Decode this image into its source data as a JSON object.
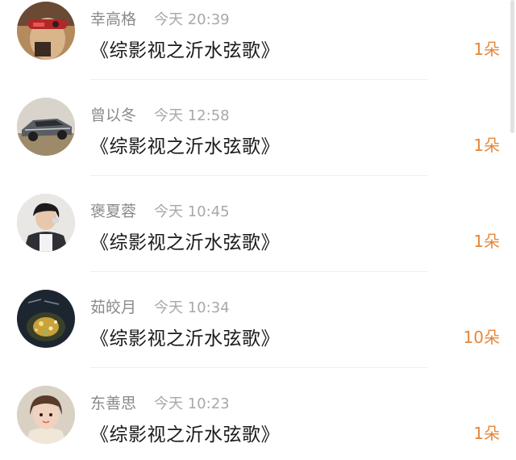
{
  "items": [
    {
      "name": "幸高格",
      "time": "今天 20:39",
      "message": "《综影视之沂水弦歌》",
      "count": "1朵",
      "avatar": "avatar-red-mask"
    },
    {
      "name": "曾以冬",
      "time": "今天 12:58",
      "message": "《综影视之沂水弦歌》",
      "count": "1朵",
      "avatar": "avatar-car"
    },
    {
      "name": "褒夏蓉",
      "time": "今天 10:45",
      "message": "《综影视之沂水弦歌》",
      "count": "1朵",
      "avatar": "avatar-person"
    },
    {
      "name": "茹皎月",
      "time": "今天 10:34",
      "message": "《综影视之沂水弦歌》",
      "count": "10朵",
      "avatar": "avatar-dark-glitter"
    },
    {
      "name": "东善思",
      "time": "今天 10:23",
      "message": "《综影视之沂水弦歌》",
      "count": "1朵",
      "avatar": "avatar-child"
    }
  ],
  "colors": {
    "accent": "#e4873a",
    "name_text": "#8a8a8a",
    "time_text": "#a8a8a8",
    "message_text": "#1a1a1a",
    "divider": "#efefef"
  }
}
